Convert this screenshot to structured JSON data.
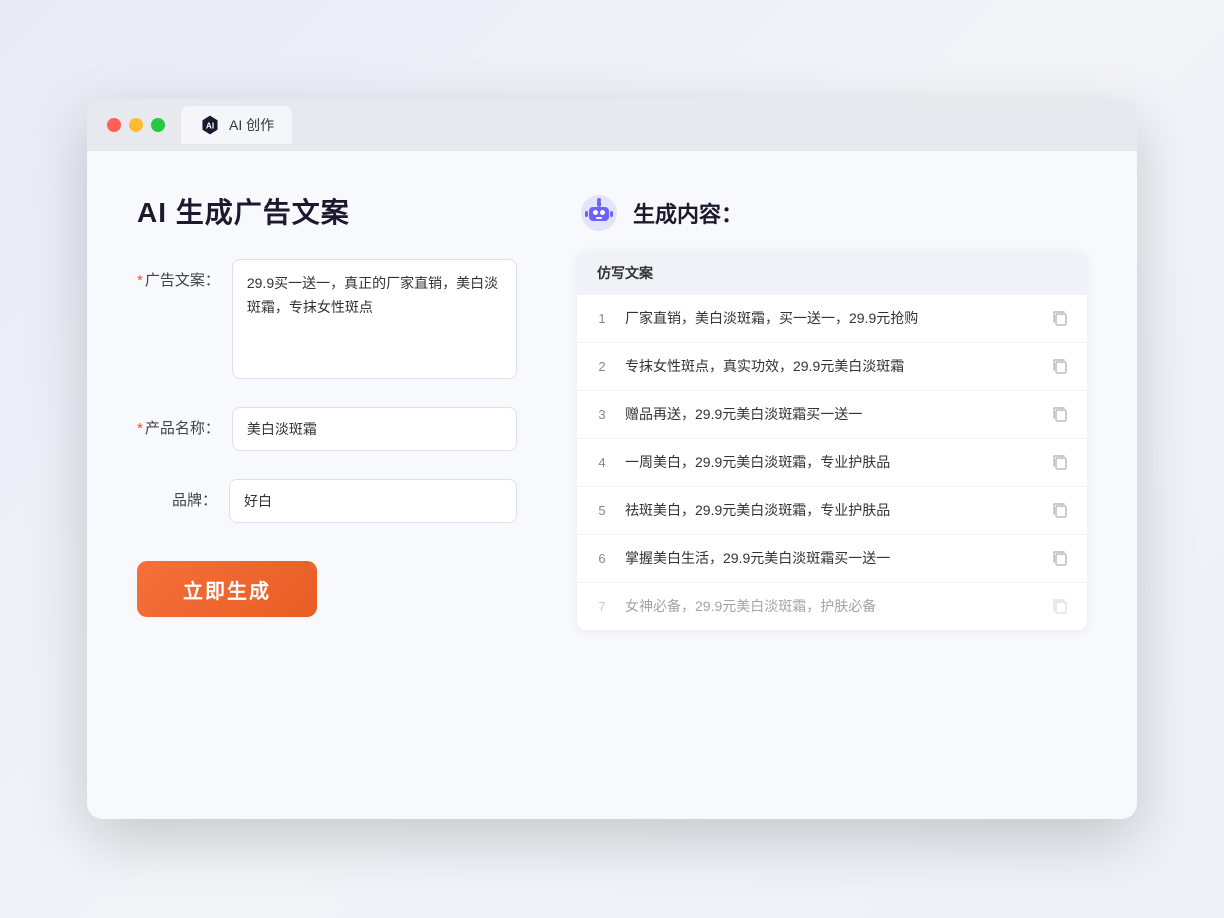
{
  "window": {
    "tab_label": "AI 创作"
  },
  "page": {
    "title": "AI 生成广告文案"
  },
  "form": {
    "ad_copy_label": "广告文案：",
    "ad_copy_required": "*",
    "ad_copy_value": "29.9买一送一，真正的厂家直销，美白淡斑霜，专抹女性斑点",
    "product_label": "产品名称：",
    "product_required": "*",
    "product_value": "美白淡斑霜",
    "brand_label": "品牌：",
    "brand_value": "好白",
    "generate_btn": "立即生成"
  },
  "result": {
    "header": "生成内容：",
    "column_label": "仿写文案",
    "rows": [
      {
        "num": "1",
        "text": "厂家直销，美白淡斑霜，买一送一，29.9元抢购",
        "dimmed": false
      },
      {
        "num": "2",
        "text": "专抹女性斑点，真实功效，29.9元美白淡斑霜",
        "dimmed": false
      },
      {
        "num": "3",
        "text": "赠品再送，29.9元美白淡斑霜买一送一",
        "dimmed": false
      },
      {
        "num": "4",
        "text": "一周美白，29.9元美白淡斑霜，专业护肤品",
        "dimmed": false
      },
      {
        "num": "5",
        "text": "祛斑美白，29.9元美白淡斑霜，专业护肤品",
        "dimmed": false
      },
      {
        "num": "6",
        "text": "掌握美白生活，29.9元美白淡斑霜买一送一",
        "dimmed": false
      },
      {
        "num": "7",
        "text": "女神必备，29.9元美白淡斑霜，护肤必备",
        "dimmed": true
      }
    ]
  }
}
